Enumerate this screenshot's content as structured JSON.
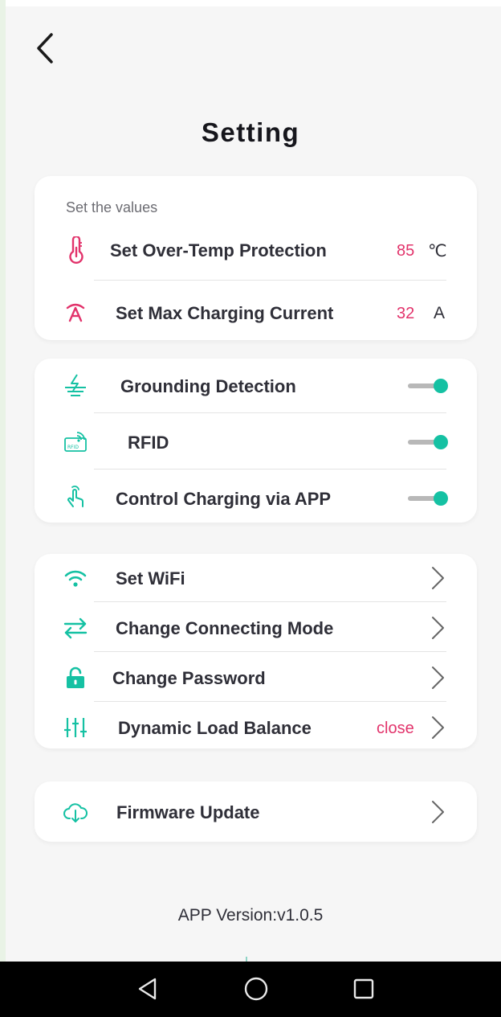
{
  "page": {
    "title": "Setting"
  },
  "colors": {
    "accent": "#15c1a3",
    "value": "#e2336b",
    "nav_bar": "#000000"
  },
  "icons": {
    "back": "chevron-left-icon",
    "over_temp": "thermometer-icon",
    "max_current": "current-icon",
    "grounding": "grounding-icon",
    "rfid": "rfid-icon",
    "app_control": "hand-touch-icon",
    "wifi": "wifi-icon",
    "connect_mode": "swap-arrows-icon",
    "password": "lock-icon",
    "load_balance": "sliders-icon",
    "firmware": "cloud-download-icon"
  },
  "values_section": {
    "caption": "Set the values",
    "items": [
      {
        "label": "Set Over-Temp Protection",
        "value": "85",
        "unit": "℃"
      },
      {
        "label": "Set Max Charging Current",
        "value": "32",
        "unit": "A"
      }
    ]
  },
  "toggles_section": {
    "items": [
      {
        "label": "Grounding Detection",
        "on": true
      },
      {
        "label": "RFID",
        "on": true
      },
      {
        "label": "Control Charging via APP",
        "on": true
      }
    ]
  },
  "links_section": {
    "items": [
      {
        "label": "Set WiFi"
      },
      {
        "label": "Change Connecting Mode"
      },
      {
        "label": "Change Password"
      },
      {
        "label": "Dynamic Load Balance",
        "status": "close"
      }
    ]
  },
  "firmware_section": {
    "label": "Firmware Update"
  },
  "footer": {
    "version": "APP Version:v1.0.5"
  },
  "navbar": {
    "buttons": [
      "back-triangle-icon",
      "home-circle-icon",
      "recents-square-icon"
    ]
  }
}
